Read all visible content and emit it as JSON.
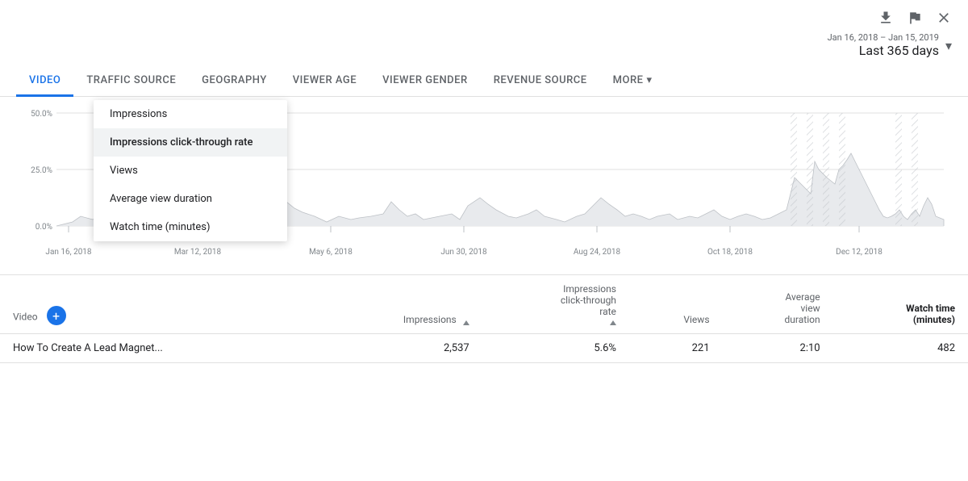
{
  "toolbar": {
    "download_label": "Download",
    "flag_label": "Flag",
    "close_label": "Close"
  },
  "date_range": {
    "subtitle": "Jan 16, 2018 – Jan 15, 2019",
    "main": "Last 365 days"
  },
  "tabs": [
    {
      "id": "video",
      "label": "VIDEO",
      "active": true
    },
    {
      "id": "traffic_source",
      "label": "TRAFFIC SOURCE",
      "active": false
    },
    {
      "id": "geography",
      "label": "GEOGRAPHY",
      "active": false
    },
    {
      "id": "viewer_age",
      "label": "VIEWER AGE",
      "active": false
    },
    {
      "id": "viewer_gender",
      "label": "VIEWER GENDER",
      "active": false
    },
    {
      "id": "revenue_source",
      "label": "REVENUE SOURCE",
      "active": false
    },
    {
      "id": "more",
      "label": "MORE",
      "active": false
    }
  ],
  "dropdown": {
    "items": [
      {
        "id": "impressions",
        "label": "Impressions",
        "selected": false
      },
      {
        "id": "impressions_ctr",
        "label": "Impressions click-through rate",
        "selected": true
      },
      {
        "id": "views",
        "label": "Views",
        "selected": false
      },
      {
        "id": "avg_view_duration",
        "label": "Average view duration",
        "selected": false
      },
      {
        "id": "watch_time",
        "label": "Watch time (minutes)",
        "selected": false
      }
    ]
  },
  "chart": {
    "y_labels": [
      "50.0%",
      "25.0%",
      "0.0%"
    ],
    "x_labels": [
      "Jan 16, 2018",
      "Mar 12, 2018",
      "May 6, 2018",
      "Jun 30, 2018",
      "Aug 24, 2018",
      "Oct 18, 2018",
      "Dec 12, 2018"
    ]
  },
  "table": {
    "columns": [
      {
        "id": "video",
        "label": "Video",
        "align": "left",
        "bold": false
      },
      {
        "id": "impressions",
        "label": "Impressions",
        "align": "right",
        "bold": false,
        "sort": true
      },
      {
        "id": "impressions_ctr",
        "label": "Impressions\nclick-through\nrate",
        "align": "right",
        "bold": false,
        "sort": true
      },
      {
        "id": "views",
        "label": "Views",
        "align": "right",
        "bold": false
      },
      {
        "id": "avg_view_duration",
        "label": "Average\nview\nduration",
        "align": "right",
        "bold": false
      },
      {
        "id": "watch_time",
        "label": "Watch time\n(minutes)",
        "align": "right",
        "bold": true
      }
    ],
    "rows": [
      {
        "video": "How To Create A Lead Magnet...",
        "impressions": "2,537",
        "impressions_ctr": "5.6%",
        "views": "221",
        "avg_view_duration": "2:10",
        "watch_time": "482"
      }
    ]
  }
}
